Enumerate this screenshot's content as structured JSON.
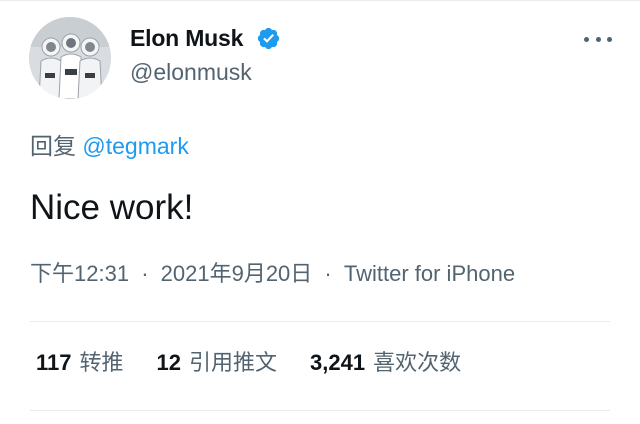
{
  "author": {
    "display_name": "Elon Musk",
    "handle": "@elonmusk",
    "verified_icon": "verified-badge-icon",
    "avatar": "profile photo: astronauts in white spacesuits"
  },
  "reply": {
    "prefix": "回复",
    "mention": "@tegmark"
  },
  "tweet": {
    "text": "Nice work!"
  },
  "meta": {
    "time": "下午12:31",
    "date": "2021年9月20日",
    "source": "Twitter for iPhone",
    "separator": "·"
  },
  "stats": [
    {
      "count": "117",
      "label": "转推"
    },
    {
      "count": "12",
      "label": "引用推文"
    },
    {
      "count": "3,241",
      "label": "喜欢次数"
    }
  ],
  "colors": {
    "text_primary": "#0f1419",
    "text_secondary": "#536471",
    "link": "#1d9bf0",
    "verified": "#1d9bf0",
    "divider": "#e6ecf0"
  }
}
